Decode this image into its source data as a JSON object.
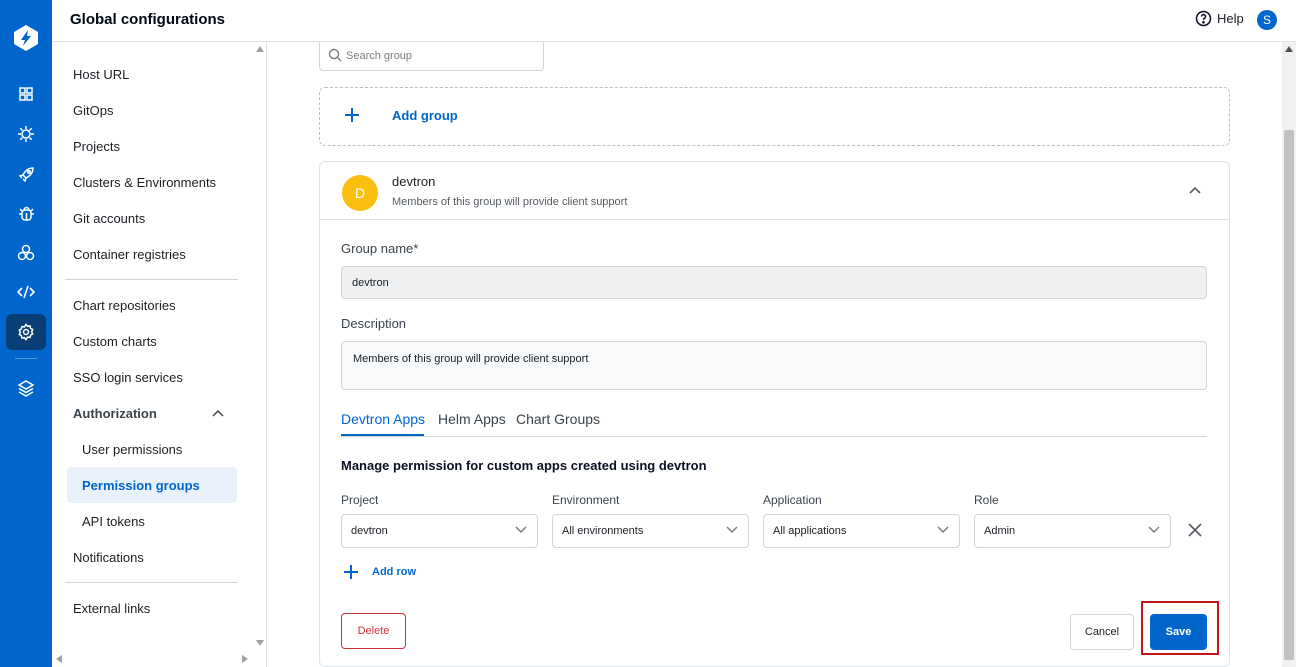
{
  "header": {
    "title": "Global configurations",
    "help_label": "Help",
    "avatar_letter": "S"
  },
  "sidebar": {
    "items": [
      {
        "label": "Host URL"
      },
      {
        "label": "GitOps"
      },
      {
        "label": "Projects"
      },
      {
        "label": "Clusters & Environments"
      },
      {
        "label": "Git accounts"
      },
      {
        "label": "Container registries"
      },
      {
        "label": "Chart repositories"
      },
      {
        "label": "Custom charts"
      },
      {
        "label": "SSO login services"
      },
      {
        "label": "Authorization"
      },
      {
        "label": "User permissions"
      },
      {
        "label": "Permission groups"
      },
      {
        "label": "API tokens"
      },
      {
        "label": "Notifications"
      },
      {
        "label": "External links"
      }
    ]
  },
  "search": {
    "placeholder": "Search group"
  },
  "add_group": {
    "label": "Add group"
  },
  "group": {
    "avatar_letter": "D",
    "name": "devtron",
    "description": "Members of this group will provide client support",
    "form": {
      "name_label": "Group name*",
      "name_value": "devtron",
      "description_label": "Description",
      "description_value": "Members of this group will provide client support"
    },
    "tabs": [
      {
        "label": "Devtron Apps",
        "active": true
      },
      {
        "label": "Helm Apps",
        "active": false
      },
      {
        "label": "Chart Groups",
        "active": false
      }
    ],
    "permissions": {
      "title": "Manage permission for custom apps created using devtron",
      "columns": [
        "Project",
        "Environment",
        "Application",
        "Role"
      ],
      "row": [
        "devtron",
        "All environments",
        "All applications",
        "Admin"
      ],
      "add_row_label": "Add row"
    },
    "buttons": {
      "delete": "Delete",
      "cancel": "Cancel",
      "save": "Save"
    }
  },
  "colors": {
    "brand": "#0066cc",
    "danger": "#d0323a",
    "avatar_group": "#fbbf0f"
  }
}
